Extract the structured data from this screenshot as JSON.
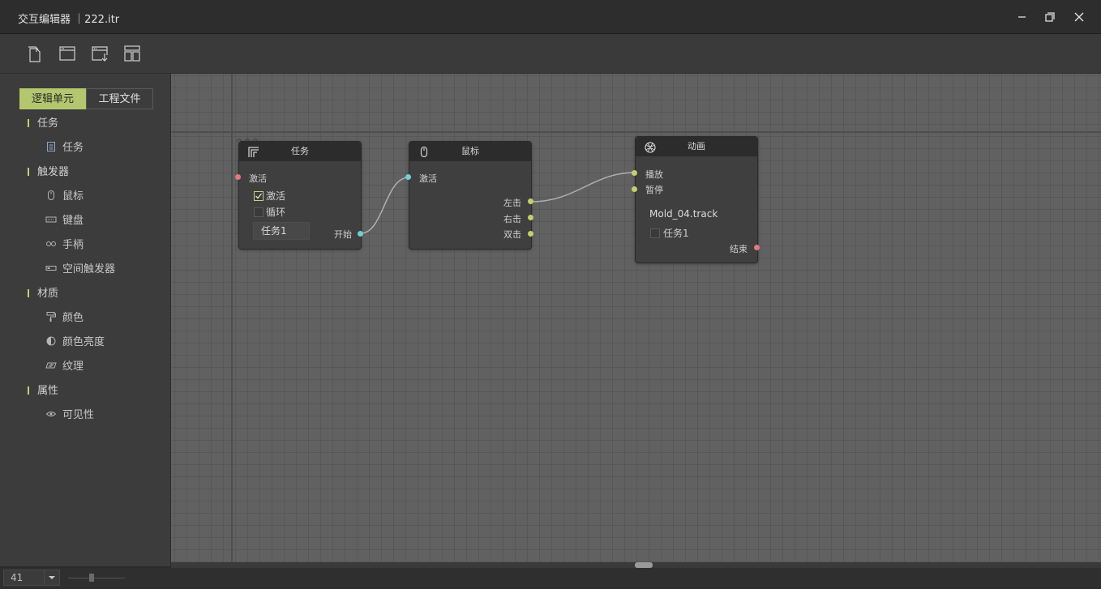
{
  "window": {
    "title": "交互编辑器 ｜222.itr"
  },
  "sidebar": {
    "tabs": [
      {
        "label": "逻辑单元"
      },
      {
        "label": "工程文件"
      }
    ],
    "categories": [
      {
        "label": "任务",
        "items": [
          {
            "label": "任务",
            "icon": "task-doc-icon"
          }
        ]
      },
      {
        "label": "触发器",
        "items": [
          {
            "label": "鼠标",
            "icon": "mouse-icon"
          },
          {
            "label": "键盘",
            "icon": "keyboard-icon"
          },
          {
            "label": "手柄",
            "icon": "gamepad-icon"
          },
          {
            "label": "空间触发器",
            "icon": "space-trigger-icon"
          }
        ]
      },
      {
        "label": "材质",
        "items": [
          {
            "label": "颜色",
            "icon": "paint-roller-icon"
          },
          {
            "label": "颜色亮度",
            "icon": "contrast-icon"
          },
          {
            "label": "纹理",
            "icon": "texture-icon"
          }
        ]
      },
      {
        "label": "属性",
        "items": [
          {
            "label": "可见性",
            "icon": "eye-icon"
          }
        ]
      }
    ]
  },
  "nodes": {
    "task": {
      "title": "任务",
      "input_label": "激活",
      "checkbox_activate": {
        "label": "激活",
        "checked": true
      },
      "checkbox_loop": {
        "label": "循环",
        "checked": false
      },
      "name_value": "任务1",
      "output_label": "开始"
    },
    "mouse": {
      "title": "鼠标",
      "input_label": "激活",
      "outputs": [
        "左击",
        "右击",
        "双击"
      ]
    },
    "animation": {
      "title": "动画",
      "inputs": [
        "播放",
        "暂停"
      ],
      "track": "Mold_04.track",
      "checkbox_task": {
        "label": "任务1",
        "checked": false
      },
      "output_label": "结束"
    }
  },
  "statusbar": {
    "zoom": "41"
  },
  "colors": {
    "accent": "#b4c66e",
    "port_red": "#e07b7b",
    "port_cyan": "#6fd0cf",
    "port_yellow": "#c6cf6a"
  }
}
